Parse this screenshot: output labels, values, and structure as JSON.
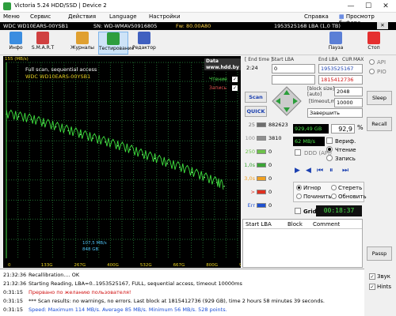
{
  "window": {
    "title": "Victoria 5.24 HDD/SSD | Device 2"
  },
  "menu": [
    "Меню",
    "Сервис",
    "Действия",
    "Language",
    "Настройки",
    "Справка",
    "Просмотр буфера"
  ],
  "info": {
    "model": "WDC WD10EARS-00YSB1",
    "sn": "SN: WD-WMAV50916805",
    "fw": "Fw: 80.00A80",
    "lba": "1953525168 LBA (1,0 TB)"
  },
  "toolbar": {
    "items": [
      "Инфо",
      "S.M.A.R.T",
      "Журналы",
      "Тестирование",
      "Редактор"
    ],
    "pause": "Пауза",
    "stop": "Стоп"
  },
  "chart": {
    "yunit": "155 (MB/s)",
    "scan": "Full scan, sequential access",
    "model": "WDC WD10EARS-00YSB1",
    "recovery": "Data recovery",
    "site": "www.hdd.by",
    "read": "Чтение",
    "write": "Запись",
    "cur_speed": "107,5 MB/s",
    "cur_pos": "848 GB",
    "xticks": [
      "0",
      "133G",
      "267G",
      "400G",
      "532G",
      "667G",
      "800G",
      "934G"
    ],
    "yticks": [
      "155",
      "140",
      "124",
      "109",
      "93",
      "77",
      "62",
      "46",
      "31",
      "15"
    ]
  },
  "chart_data": {
    "type": "line",
    "title": "Full scan, sequential access",
    "ylabel": "MB/s",
    "xlabel": "",
    "ylim": [
      0,
      155
    ],
    "xlim": [
      0,
      934
    ],
    "series": [
      {
        "name": "Чтение",
        "x": [
          0,
          50,
          100,
          150,
          200,
          250,
          300,
          350,
          400,
          450,
          500,
          550,
          600,
          650,
          700,
          750,
          800,
          850,
          880
        ],
        "y": [
          114,
          112,
          110,
          107,
          104,
          101,
          98,
          95,
          92,
          89,
          86,
          82,
          79,
          75,
          72,
          68,
          64,
          60,
          57
        ]
      }
    ]
  },
  "control": {
    "end_time": "End time",
    "end_val": "2:24",
    "start_lba": "Start LBA",
    "start_val": "0",
    "end_lba": "End LBA",
    "end_lba_val": "1953525167",
    "cur": "CUR",
    "max": "MAX",
    "cur_lba": "1815412736",
    "block_size": "block size",
    "block_auto": "auto",
    "block_val": "2048",
    "timeout": "timeout,ms",
    "timeout_val": "10000",
    "scan": "Scan",
    "quick": "QUICK",
    "action": "Завершить"
  },
  "counts": {
    "labels": [
      "25",
      "100",
      "250",
      "1,0s",
      "3,0s",
      ">",
      "Err"
    ],
    "values": [
      "882623",
      "3810",
      "0",
      "0",
      "0",
      "0",
      "0"
    ],
    "colors": [
      "#6e6e6e",
      "#909090",
      "#6cc24a",
      "#3aa535",
      "#f0a020",
      "#e03020",
      "#1e50d0"
    ]
  },
  "stats": {
    "done": "929,49 GB",
    "pct": "92,9",
    "pct_unit": "%",
    "speed": "62 MB/s",
    "verify": "Вериф.",
    "read": "Чтение",
    "write": "Запись",
    "ddd": "DDD (API)"
  },
  "repair": {
    "ignore": "Игнор",
    "erase": "Стереть",
    "remap": "Починить",
    "refresh": "Обновить"
  },
  "grid": {
    "label": "Grid",
    "timer": "00:18:37"
  },
  "table": {
    "cols": [
      "Start LBA",
      "Block",
      "Comment"
    ]
  },
  "side": {
    "api": "API",
    "pio": "PIO",
    "sleep": "Sleep",
    "recall": "Recall",
    "passp": "Passp"
  },
  "log": [
    {
      "t": "21:32:36",
      "msg": "Recallibration.... OK",
      "color": "#000000"
    },
    {
      "t": "21:32:36",
      "msg": "Starting Reading, LBA=0..1953525167, FULL, sequential access, timeout 10000ms",
      "color": "#000000"
    },
    {
      "t": "0:31:15",
      "msg": "Прервано по желанию пользователя!",
      "color": "#d01010"
    },
    {
      "t": "0:31:15",
      "msg": "*** Scan results: no warnings, no errors. Last block at 1815412736 (929 GB), time 2 hours 58 minutes 39 seconds.",
      "color": "#000000"
    },
    {
      "t": "0:31:15",
      "msg": "Speed: Maximum 114 MB/s. Average 85 MB/s. Minimum 56 MB/s. 528 points.",
      "color": "#1a4fd6"
    }
  ],
  "sound": {
    "zvuk": "Звук",
    "hints": "Hints"
  }
}
